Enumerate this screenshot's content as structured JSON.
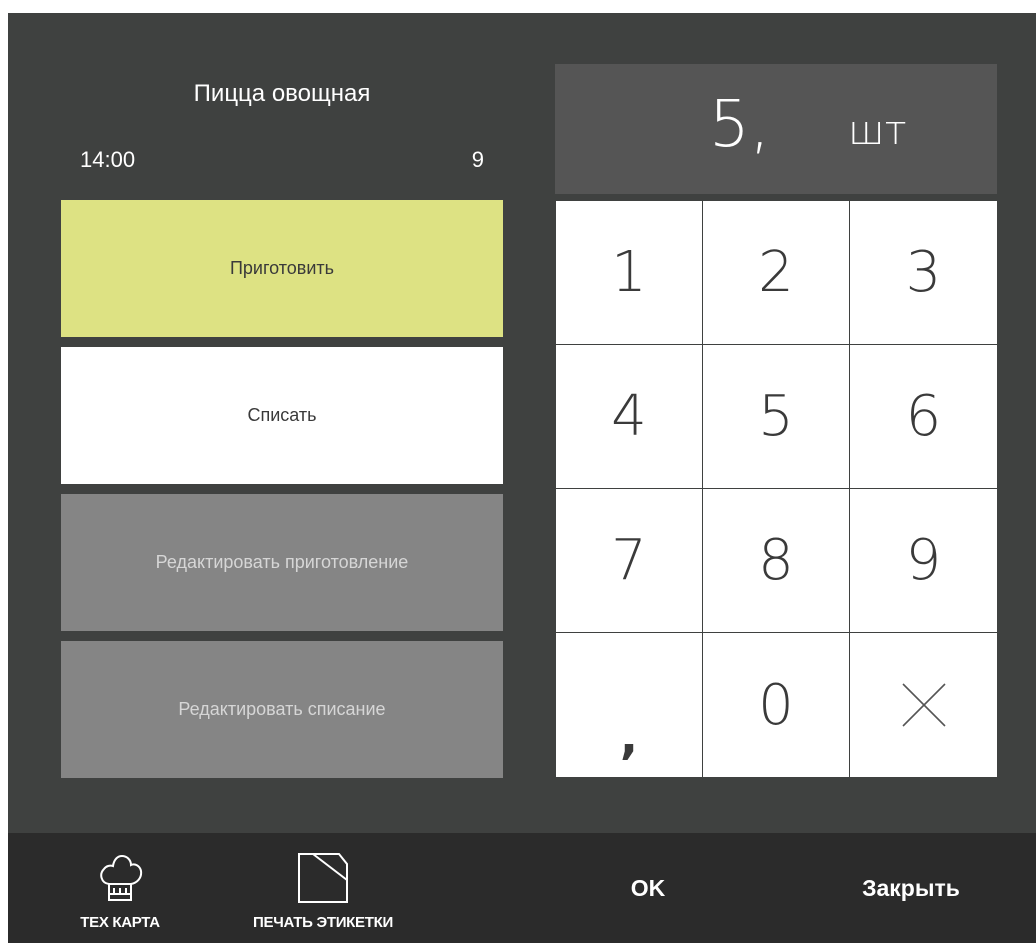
{
  "header": {
    "title": "Пицца овощная",
    "time": "14:00",
    "count": "9"
  },
  "actions": {
    "cook": "Приготовить",
    "writeoff": "Списать",
    "edit_cook": "Редактировать приготовление",
    "edit_writeoff": "Редактировать списание"
  },
  "display": {
    "value": "5,",
    "unit": "шт"
  },
  "keypad": {
    "k1": "1",
    "k2": "2",
    "k3": "3",
    "k4": "4",
    "k5": "5",
    "k6": "6",
    "k7": "7",
    "k8": "8",
    "k9": "9",
    "comma": ",",
    "k0": "0",
    "clear_icon": "close-icon"
  },
  "footer": {
    "tech_card_label": "ТЕХ КАРТА",
    "tech_card_icon": "chef-hat-icon",
    "print_label": "ПЕЧАТЬ ЭТИКЕТКИ",
    "print_icon": "label-icon",
    "ok_label": "OK",
    "close_label": "Закрыть"
  },
  "colors": {
    "panel": "#3f4140",
    "cook_button": "#dde283",
    "disabled_button": "#858585",
    "display_bg": "#555555",
    "footer_bg": "#2b2b2b"
  }
}
